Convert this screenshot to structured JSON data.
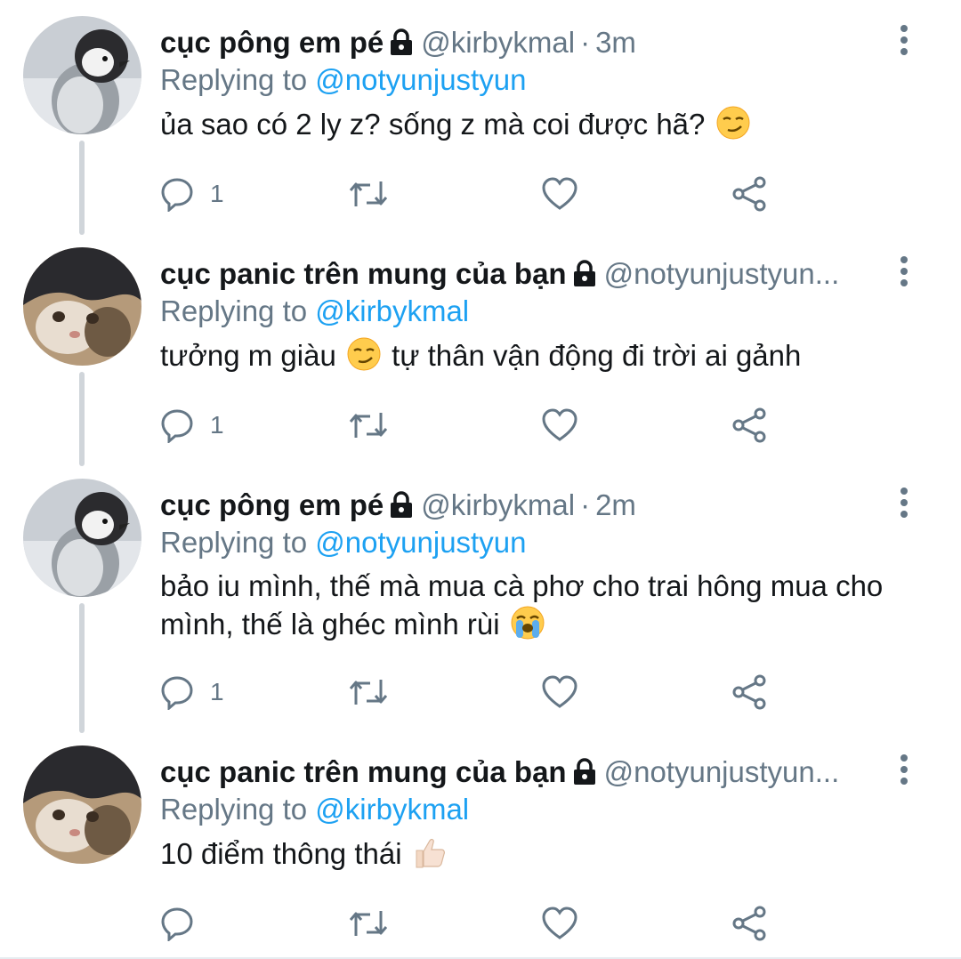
{
  "colors": {
    "text": "#14171a",
    "secondary": "#657786",
    "link": "#1da1f2",
    "thread_line": "#d0d5da"
  },
  "tweets": [
    {
      "name": "cục pông em pé",
      "handle": "@kirbykmal",
      "separator": "·",
      "time": "3m",
      "replying_label": "Replying to",
      "replying_to": "@notyunjustyun",
      "text_before": "ủa sao có 2 ly z? sống z mà coi được hã?",
      "text_after": "",
      "emoji": "smirking-face",
      "reply_count": "1",
      "avatar": "penguin-chick",
      "locked": true
    },
    {
      "name": "cục panic trên mung của bạn",
      "handle": "@notyunjustyun...",
      "separator": "",
      "time": "",
      "replying_label": "Replying to",
      "replying_to": "@kirbykmal",
      "text_before": "tưởng m giàu",
      "text_after": "tự thân vận động đi trời ai gảnh",
      "emoji": "smirking-face",
      "reply_count": "1",
      "avatar": "cat-face",
      "locked": true
    },
    {
      "name": "cục pông em pé",
      "handle": "@kirbykmal",
      "separator": "·",
      "time": "2m",
      "replying_label": "Replying to",
      "replying_to": "@notyunjustyun",
      "text_before": "bảo iu mình, thế mà mua cà phơ cho trai hông mua cho mình, thế là ghéc mình rùi",
      "text_after": "",
      "emoji": "loudly-crying-face",
      "reply_count": "1",
      "avatar": "penguin-chick",
      "locked": true
    },
    {
      "name": "cục panic trên mung của bạn",
      "handle": "@notyunjustyun...",
      "separator": "",
      "time": "",
      "replying_label": "Replying to",
      "replying_to": "@kirbykmal",
      "text_before": "10 điểm thông thái",
      "text_after": "",
      "emoji": "thumbs-up-light-skin",
      "reply_count": "",
      "avatar": "cat-face",
      "locked": true
    }
  ]
}
